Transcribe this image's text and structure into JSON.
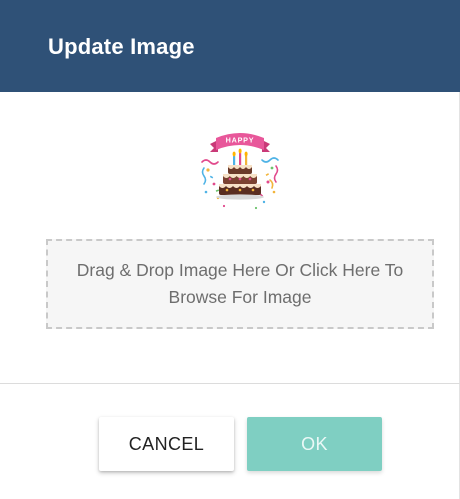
{
  "dialog": {
    "title": "Update Image",
    "preview_banner_text": "HAPPY",
    "dropzone_text": "Drag & Drop Image Here Or Click Here To Browse For Image",
    "cancel_label": "CANCEL",
    "ok_label": "OK"
  },
  "colors": {
    "header": "#2f5177",
    "ok_button": "#7fcfc2",
    "dropzone_bg": "#f6f6f6",
    "dropzone_border": "#c9c9c9"
  }
}
